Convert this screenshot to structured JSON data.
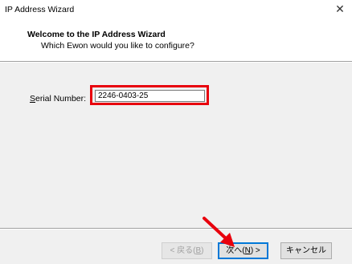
{
  "window": {
    "title": "IP Address Wizard",
    "close_glyph": "✕"
  },
  "header": {
    "title": "Welcome to the IP Address Wizard",
    "subtitle": "Which Ewon would you like to configure?"
  },
  "form": {
    "serial_label_mnemonic": "S",
    "serial_label_rest": "erial Number:",
    "serial_value": "2246-0403-25"
  },
  "buttons": {
    "back_prefix": "< 戻る(",
    "back_key": "B",
    "back_suffix": ")",
    "next_prefix": "次へ(",
    "next_key": "N",
    "next_suffix": ") >",
    "cancel_label": "キャンセル"
  },
  "annotations": {
    "highlight_color": "#e8000d",
    "arrow_color": "#e8000d"
  },
  "icons": {
    "close": "close-icon",
    "arrow": "red-arrow-annotation"
  }
}
